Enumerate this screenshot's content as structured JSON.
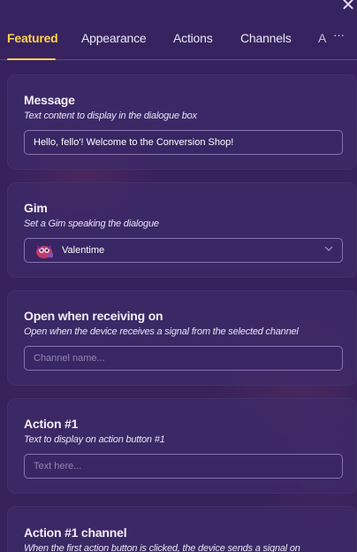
{
  "close_label": "✕",
  "tabs": [
    {
      "label": "Featured",
      "active": true
    },
    {
      "label": "Appearance",
      "active": false
    },
    {
      "label": "Actions",
      "active": false
    },
    {
      "label": "Channels",
      "active": false
    },
    {
      "label": "A",
      "active": false
    }
  ],
  "more_icon_glyph": "···",
  "cards": {
    "message": {
      "title": "Message",
      "description": "Text content to display in the dialogue box",
      "value": "Hello, fello'! Welcome to the Conversion Shop!"
    },
    "gim": {
      "title": "Gim",
      "description": "Set a Gim speaking the dialogue",
      "value": "Valentime"
    },
    "open_when": {
      "title": "Open when receiving on",
      "description": "Open when the device receives a signal from the selected channel",
      "placeholder": "Channel name..."
    },
    "action1": {
      "title": "Action #1",
      "description": "Text to display on action button #1",
      "placeholder": "Text here..."
    },
    "action1_channel": {
      "title": "Action #1 channel",
      "description": "When the first action button is clicked, the device sends a signal on"
    }
  },
  "colors": {
    "accent": "#ffd24a",
    "background": "#3a2463",
    "card": "#3e2a68"
  }
}
